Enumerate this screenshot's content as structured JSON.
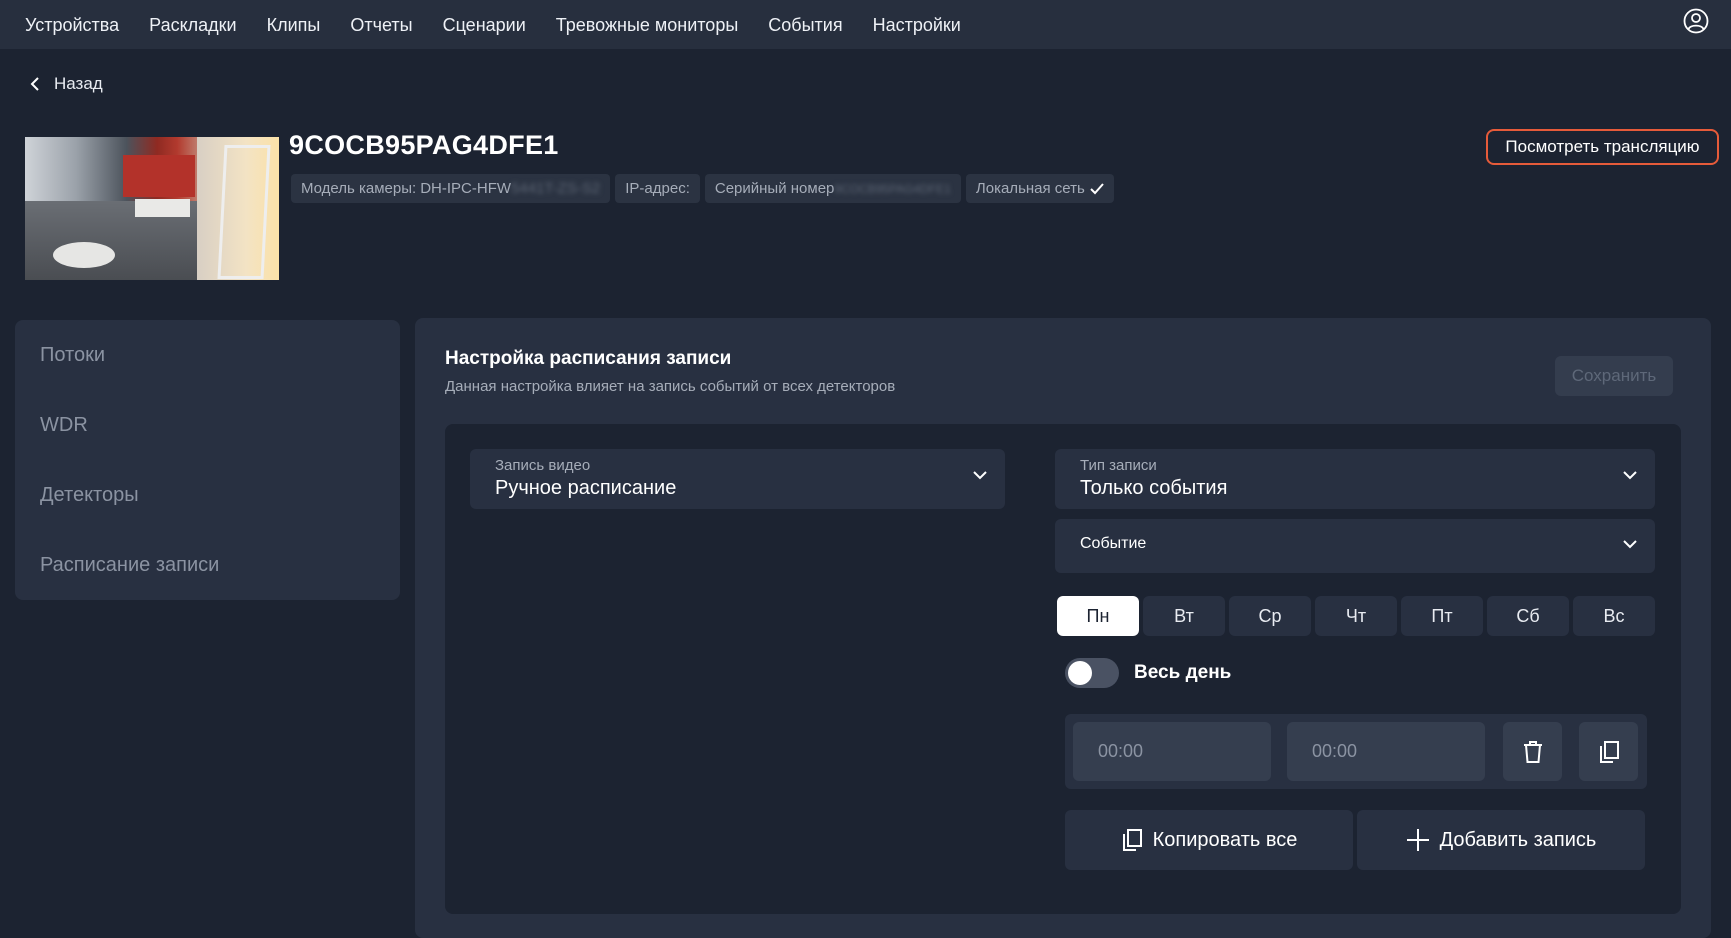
{
  "nav": {
    "items": [
      "Устройства",
      "Раскладки",
      "Клипы",
      "Отчеты",
      "Сценарии",
      "Тревожные мониторы",
      "События",
      "Настройки"
    ]
  },
  "back_label": "Назад",
  "camera": {
    "title": "9COCB95PAG4DFE1",
    "chips": {
      "model_label": "Модель камеры:",
      "model_value": "DH-IPC-HFW",
      "model_hidden": "5441T-ZS-S2",
      "ip_label": "IP-адрес:",
      "serial_label": "Серийный номер",
      "serial_hidden": "9COCB95PAG4DFE1",
      "network_label": "Локальная сеть"
    },
    "watch_button": "Посмотреть трансляцию"
  },
  "sidebar": {
    "items": [
      "Потоки",
      "WDR",
      "Детекторы",
      "Расписание записи"
    ]
  },
  "panel": {
    "title": "Настройка расписания записи",
    "subtitle": "Данная настройка влияет на запись событий от всех детекторов",
    "save_button": "Сохранить",
    "video_recording": {
      "label": "Запись видео",
      "value": "Ручное расписание"
    },
    "record_type": {
      "label": "Тип записи",
      "value": "Только события"
    },
    "event": {
      "label": "Событие"
    },
    "days": [
      "Пн",
      "Вт",
      "Ср",
      "Чт",
      "Пт",
      "Сб",
      "Вс"
    ],
    "active_day": "Пн",
    "all_day_label": "Весь день",
    "all_day_enabled": false,
    "time_from_placeholder": "00:00",
    "time_to_placeholder": "00:00",
    "copy_all_button": "Копировать все",
    "add_entry_button": "Добавить запись"
  }
}
